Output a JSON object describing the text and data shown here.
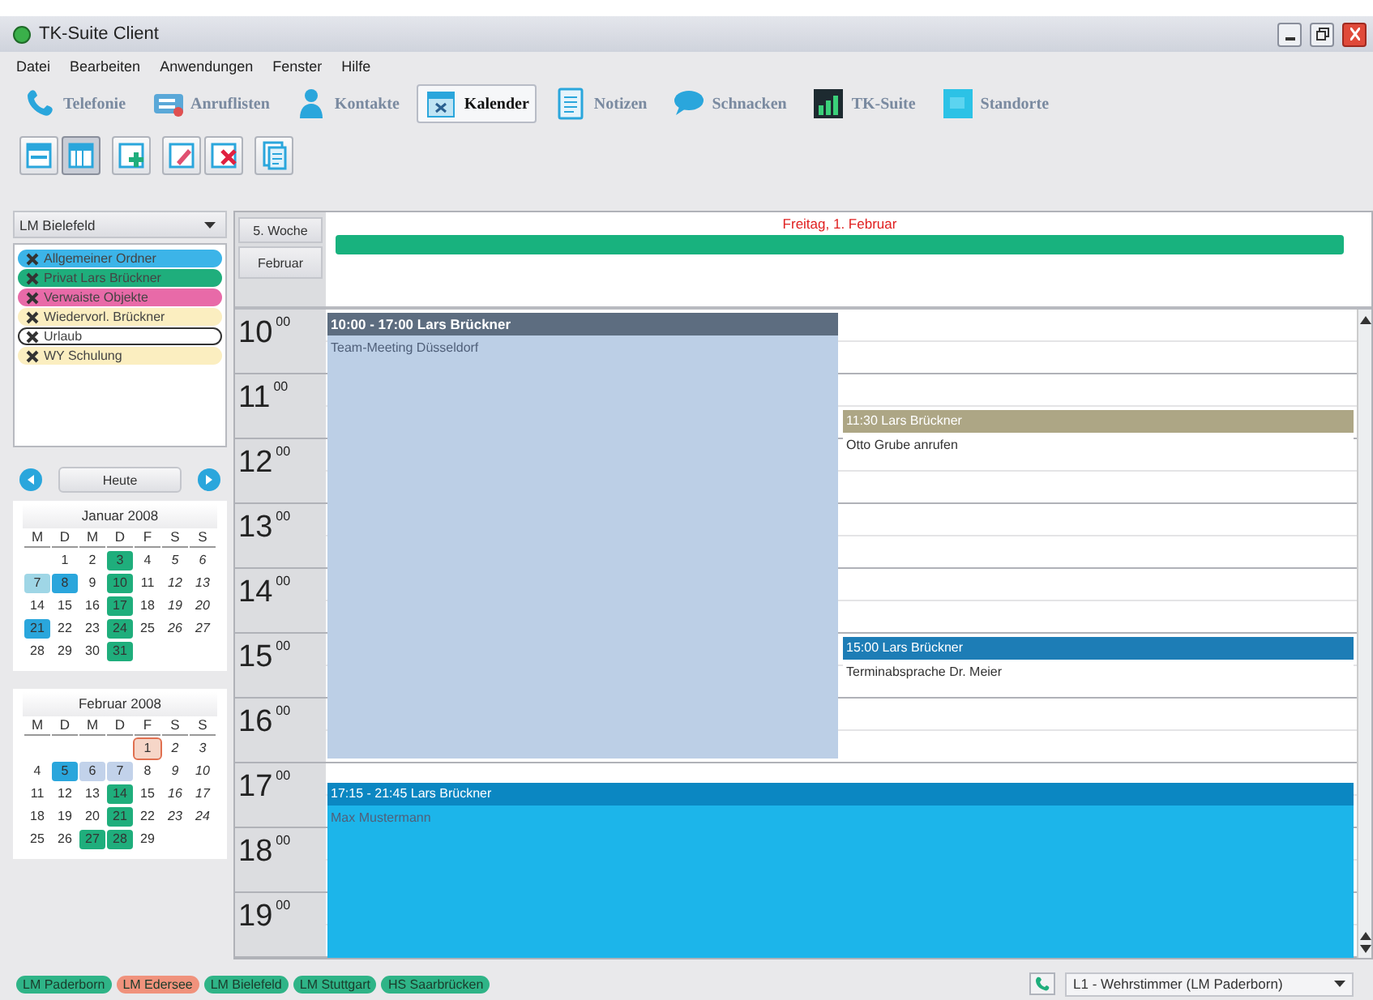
{
  "window": {
    "title": "TK-Suite Client"
  },
  "menu": [
    "Datei",
    "Bearbeiten",
    "Anwendungen",
    "Fenster",
    "Hilfe"
  ],
  "apps": [
    {
      "label": "Telefonie",
      "selected": false
    },
    {
      "label": "Anruflisten",
      "selected": false
    },
    {
      "label": "Kontakte",
      "selected": false
    },
    {
      "label": "Kalender",
      "selected": true
    },
    {
      "label": "Notizen",
      "selected": false
    },
    {
      "label": "Schnacken",
      "selected": false
    },
    {
      "label": "TK-Suite",
      "selected": false
    },
    {
      "label": "Standorte",
      "selected": false
    }
  ],
  "view_toggle": [
    {
      "selected": false
    },
    {
      "selected": true
    }
  ],
  "sidebar": {
    "location": "LM Bielefeld",
    "calendars": [
      {
        "label": "Allgemeiner Ordner",
        "color": "#3cb4e8",
        "selected": false
      },
      {
        "label": "Privat Lars Brückner",
        "color": "#1fae7c",
        "selected": false
      },
      {
        "label": "Verwaiste Objekte",
        "color": "#e86aa8",
        "selected": false
      },
      {
        "label": "Wiedervorl. Brückner",
        "color": "#fbeec0",
        "selected": false
      },
      {
        "label": "Urlaub",
        "color": "#ffffff",
        "selected": true
      },
      {
        "label": "WY Schulung",
        "color": "#fbeec0",
        "selected": false
      }
    ],
    "today_button": "Heute",
    "months": [
      {
        "title": "Januar 2008",
        "weekdays": [
          "M",
          "D",
          "M",
          "D",
          "F",
          "S",
          "S"
        ],
        "weeks": [
          [
            {
              "d": "1",
              "today": false
            },
            {
              "d": "2",
              "today": false
            },
            {
              "d": "3",
              "color": "#1fae7c",
              "today": false
            },
            {
              "d": "4",
              "today": false
            },
            {
              "d": "5",
              "today": false
            },
            {
              "d": "6",
              "today": false
            }
          ],
          [
            {
              "d": "7",
              "color": "#9fd6e6",
              "today": false
            },
            {
              "d": "8",
              "color": "#2aa6dc",
              "today": false
            },
            {
              "d": "9",
              "today": false
            },
            {
              "d": "10",
              "color": "#1fae7c",
              "today": false
            },
            {
              "d": "11",
              "today": false
            },
            {
              "d": "12",
              "today": false
            },
            {
              "d": "13",
              "today": false
            }
          ],
          [
            {
              "d": "14",
              "today": false
            },
            {
              "d": "15",
              "today": false
            },
            {
              "d": "16",
              "today": false
            },
            {
              "d": "17",
              "color": "#1fae7c",
              "today": false
            },
            {
              "d": "18",
              "today": false
            },
            {
              "d": "19",
              "today": false
            },
            {
              "d": "20",
              "today": false
            }
          ],
          [
            {
              "d": "21",
              "color": "#2aa6dc",
              "today": false
            },
            {
              "d": "22",
              "today": false
            },
            {
              "d": "23",
              "today": false
            },
            {
              "d": "24",
              "color": "#1fae7c",
              "today": false
            },
            {
              "d": "25",
              "today": false
            },
            {
              "d": "26",
              "today": false
            },
            {
              "d": "27",
              "today": false
            }
          ],
          [
            {
              "d": "28",
              "today": false
            },
            {
              "d": "29",
              "today": false
            },
            {
              "d": "30",
              "today": false
            },
            {
              "d": "31",
              "color": "#1fae7c",
              "today": false
            }
          ]
        ]
      },
      {
        "title": "Februar 2008",
        "weekdays": [
          "M",
          "D",
          "M",
          "D",
          "F",
          "S",
          "S"
        ],
        "weeks": [
          [
            {
              "d": "1",
              "today": true
            },
            {
              "d": "2",
              "today": false
            },
            {
              "d": "3",
              "today": false
            }
          ],
          [
            {
              "d": "4",
              "today": false
            },
            {
              "d": "5",
              "color": "#2aa6dc",
              "today": false
            },
            {
              "d": "6",
              "color": "#c2d2ea",
              "today": false
            },
            {
              "d": "7",
              "color": "#c2d2ea",
              "today": false
            },
            {
              "d": "8",
              "today": false
            },
            {
              "d": "9",
              "today": false
            },
            {
              "d": "10",
              "today": false
            }
          ],
          [
            {
              "d": "11",
              "today": false
            },
            {
              "d": "12",
              "today": false
            },
            {
              "d": "13",
              "today": false
            },
            {
              "d": "14",
              "color": "#1fae7c",
              "today": false
            },
            {
              "d": "15",
              "today": false
            },
            {
              "d": "16",
              "today": false
            },
            {
              "d": "17",
              "today": false
            }
          ],
          [
            {
              "d": "18",
              "today": false
            },
            {
              "d": "19",
              "today": false
            },
            {
              "d": "20",
              "today": false
            },
            {
              "d": "21",
              "color": "#1fae7c",
              "today": false
            },
            {
              "d": "22",
              "today": false
            },
            {
              "d": "23",
              "today": false
            },
            {
              "d": "24",
              "today": false
            }
          ],
          [
            {
              "d": "25",
              "today": false
            },
            {
              "d": "26",
              "today": false
            },
            {
              "d": "27",
              "color": "#1fae7c",
              "today": false
            },
            {
              "d": "28",
              "color": "#1fae7c",
              "today": false
            },
            {
              "d": "29",
              "today": false
            }
          ]
        ]
      }
    ]
  },
  "calendar": {
    "week": "5. Woche",
    "month": "Februar",
    "day": "Freitag, 1. Februar",
    "all_day": {
      "color": "#18b27e"
    },
    "hours": [
      {
        "hour": "10",
        "minutes": "00"
      },
      {
        "hour": "11",
        "minutes": "00"
      },
      {
        "hour": "12",
        "minutes": "00"
      },
      {
        "hour": "13",
        "minutes": "00"
      },
      {
        "hour": "14",
        "minutes": "00"
      },
      {
        "hour": "15",
        "minutes": "00"
      },
      {
        "hour": "16",
        "minutes": "00"
      },
      {
        "hour": "17",
        "minutes": "00"
      },
      {
        "hour": "18",
        "minutes": "00"
      },
      {
        "hour": "19",
        "minutes": "00"
      }
    ],
    "events": [
      {
        "title": "10:00 - 17:00 Lars Brückner",
        "color": "#5d6d80",
        "body": {
          "text": "Team-Meeting Düsseldorf",
          "color": "#bccfe6"
        }
      },
      {
        "title": "11:30 Lars Brückner",
        "color": "#ada685",
        "body": {
          "text": "Otto Grube anrufen",
          "color": "#ffffff"
        }
      },
      {
        "title": "15:00 Lars Brückner",
        "color": "#1d7db6",
        "body": {
          "text": "Terminabsprache Dr. Meier",
          "color": "#ffffff"
        }
      },
      {
        "title": "17:15 - 21:45 Lars Brückner",
        "color": "#0b87c2",
        "body": {
          "text": "Max Mustermann",
          "color": "#1cb5ea"
        }
      }
    ]
  },
  "status_bar": {
    "locations": [
      {
        "label": "LM Paderborn",
        "color": "#2fb487"
      },
      {
        "label": "LM Edersee",
        "color": "#f0927c"
      },
      {
        "label": "LM Bielefeld",
        "color": "#2fb487"
      },
      {
        "label": "LM Stuttgart",
        "color": "#2fb487"
      },
      {
        "label": "HS Saarbrücken",
        "color": "#2fb487"
      }
    ],
    "line": "L1 - Wehrstimmer (LM Paderborn)"
  }
}
